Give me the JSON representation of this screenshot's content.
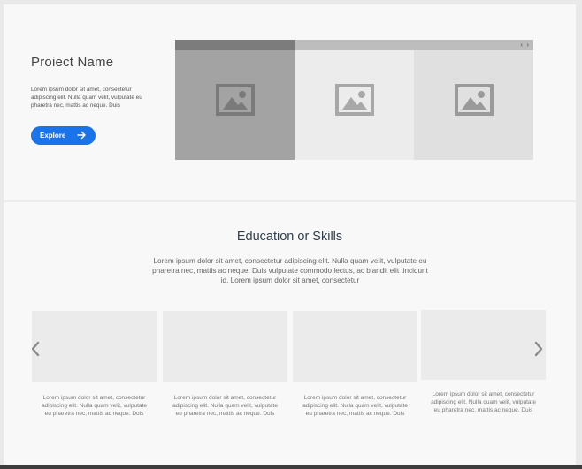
{
  "hero": {
    "title": "Proiect Name",
    "text": "Lorem ipsum dolor sit amet, consectetur adipiscing elit. Nulla quam velit, vulputate eu pharetra nec, mattis ac neque. Duis",
    "button_label": "Explore",
    "button_icon": "arrow-right-icon",
    "button_color": "#1a73e8"
  },
  "gallery": {
    "nav_prev": "‹",
    "nav_next": "›",
    "tiles": [
      {
        "icon": "image-icon",
        "shade": "dark"
      },
      {
        "icon": "image-icon",
        "shade": "light"
      },
      {
        "icon": "image-icon",
        "shade": "light"
      }
    ]
  },
  "section": {
    "title": "Education or Skills",
    "text": "Lorem ipsum dolor sit amet, consectetur adipiscing elit. Nulla quam velit, vulputate eu pharetra nec, mattis ac neque. Duis vulputate commodo lectus, ac blandit elit tincidunt id. Lorem ipsum dolor sit amet, consectetur",
    "prev_icon": "chevron-left-icon",
    "next_icon": "chevron-right-icon",
    "cards": [
      {
        "text": "Lorem ipsum dolor sit amet, consectetur adipiscing elit. Nulla quam velit, vulputate eu pharetra nec, mattis ac neque. Duis"
      },
      {
        "text": "Lorem ipsum dolor sit amet, consectetur adipiscing elit. Nulla quam velit, vulputate eu pharetra nec, mattis ac neque. Duis"
      },
      {
        "text": "Lorem ipsum dolor sit amet, consectetur adipiscing elit. Nulla quam velit, vulputate eu pharetra nec, mattis ac neque. Duis"
      },
      {
        "text": "Lorem ipsum dolor sit amet, consectetur adipiscing elit. Nulla quam velit, vulputate eu pharetra nec, mattis ac neque. Duis"
      }
    ]
  }
}
